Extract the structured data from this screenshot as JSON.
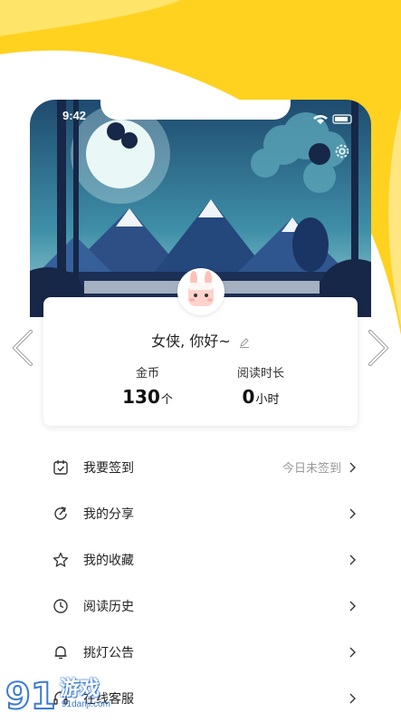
{
  "status_bar": {
    "time": "9:42"
  },
  "profile": {
    "greeting": "女侠, 你好~",
    "stats": [
      {
        "label": "金币",
        "value": "130",
        "unit": "个"
      },
      {
        "label": "阅读时长",
        "value": "0",
        "unit": "小时"
      }
    ]
  },
  "menu": [
    {
      "label": "我要签到",
      "value": "今日未签到",
      "icon": "calendar-check-icon"
    },
    {
      "label": "我的分享",
      "value": "",
      "icon": "share-icon"
    },
    {
      "label": "我的收藏",
      "value": "",
      "icon": "star-icon"
    },
    {
      "label": "阅读历史",
      "value": "",
      "icon": "clock-icon"
    },
    {
      "label": "挑灯公告",
      "value": "",
      "icon": "bell-icon"
    },
    {
      "label": "在线客服",
      "value": "",
      "icon": "headset-icon"
    }
  ],
  "watermark": {
    "brand": "游戏",
    "site": "91danji.com"
  },
  "colors": {
    "accent_yellow": "#FFD21F",
    "sky_dark": "#1f3b6b",
    "sky_light": "#5bb7c9"
  }
}
